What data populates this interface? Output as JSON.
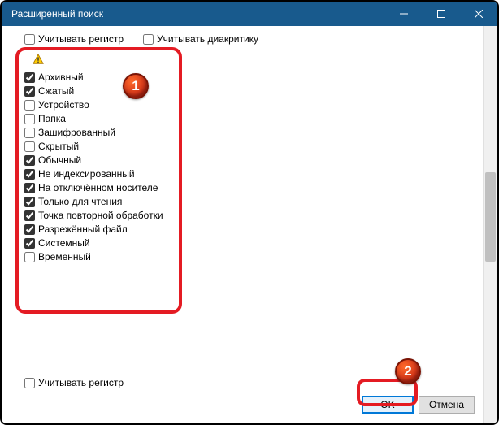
{
  "titlebar": {
    "title": "Расширенный поиск"
  },
  "top": {
    "case": {
      "label": "Учитывать регистр",
      "checked": false
    },
    "diacritics": {
      "label": "Учитывать диакритику",
      "checked": false
    }
  },
  "attributes": [
    {
      "label": "Архивный",
      "checked": true
    },
    {
      "label": "Сжатый",
      "checked": true
    },
    {
      "label": "Устройство",
      "checked": false
    },
    {
      "label": "Папка",
      "checked": false
    },
    {
      "label": "Зашифрованный",
      "checked": false
    },
    {
      "label": "Скрытый",
      "checked": false
    },
    {
      "label": "Обычный",
      "checked": true
    },
    {
      "label": "Не индексированный",
      "checked": true
    },
    {
      "label": "На отключённом носителе",
      "checked": true
    },
    {
      "label": "Только для чтения",
      "checked": true
    },
    {
      "label": "Точка повторной обработки",
      "checked": true
    },
    {
      "label": "Разрежённый файл",
      "checked": true
    },
    {
      "label": "Системный",
      "checked": true
    },
    {
      "label": "Временный",
      "checked": false
    }
  ],
  "bottom": {
    "case2": {
      "label": "Учитывать регистр",
      "checked": false
    }
  },
  "buttons": {
    "ok": "OK",
    "cancel": "Отмена"
  },
  "callouts": {
    "one": "1",
    "two": "2"
  }
}
